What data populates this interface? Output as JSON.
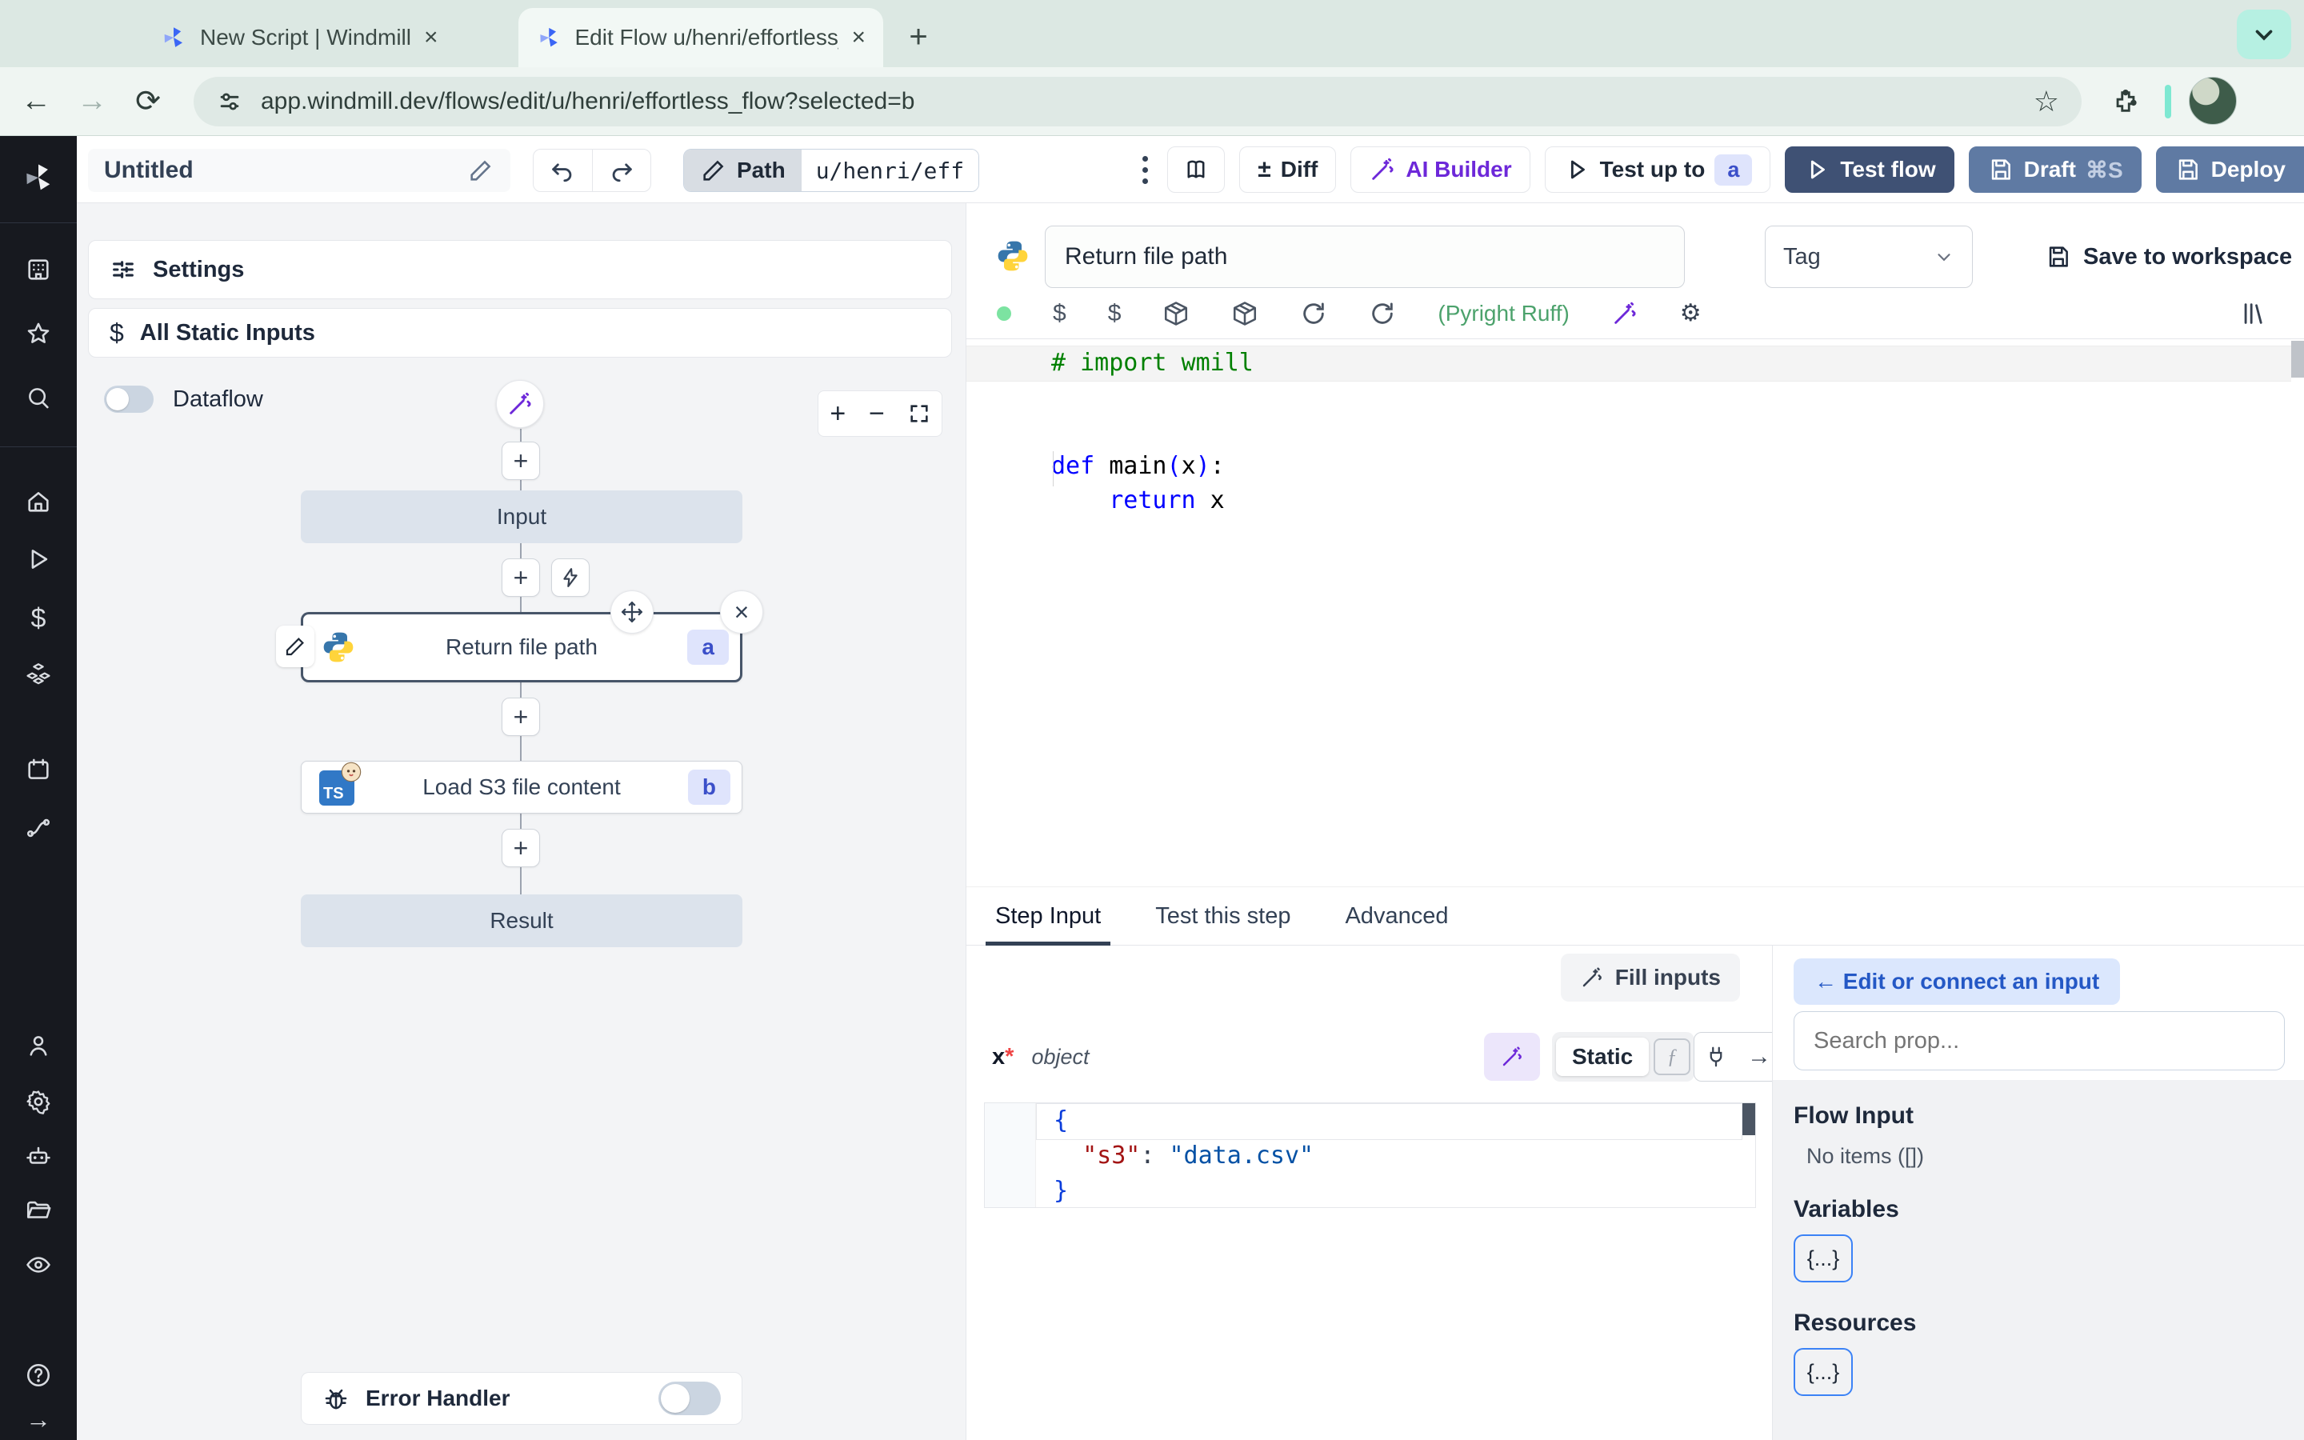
{
  "browser": {
    "tab1": "New Script | Windmill",
    "tab2": "Edit Flow u/henri/effortless_fl",
    "url": "app.windmill.dev/flows/edit/u/henri/effortless_flow?selected=b",
    "new_tab": "+",
    "close": "×"
  },
  "toolbar": {
    "title": "Untitled",
    "path_label": "Path",
    "path_value": "u/henri/eff",
    "diff_label": "Diff",
    "diff_icon": "±",
    "ai_builder_label": "AI Builder",
    "test_up_to_label": "Test up to",
    "step_badge_a": "a",
    "test_flow_label": "Test flow",
    "draft_label": "Draft",
    "draft_shortcut": "⌘S",
    "deploy_label": "Deploy"
  },
  "flow": {
    "settings_label": "Settings",
    "all_static_inputs_label": "All Static Inputs",
    "static_icon": "$",
    "dataflow_label": "Dataflow",
    "input_node": "Input",
    "step_a_label": "Return file path",
    "step_a_id": "a",
    "step_b_label": "Load S3 file content",
    "step_b_lang": "TS",
    "step_b_id": "b",
    "result_node": "Result",
    "error_handler_label": "Error Handler",
    "plus": "+",
    "minus": "−"
  },
  "step": {
    "name": "Return file path",
    "tag_label": "Tag",
    "save_label": "Save to workspace",
    "dollar1": "$",
    "dollar2": "$",
    "lint_status": "(Pyright Ruff)",
    "gear": "⚙",
    "code": {
      "comment": "# import wmill",
      "kw_def": "def",
      "fn_name": " main",
      "paren_open": "(",
      "arg": "x",
      "paren_close": ")",
      "colon": ":",
      "kw_return": "return",
      "ret_value": " x"
    },
    "tabs": {
      "step_input": "Step Input",
      "test_this_step": "Test this step",
      "advanced": "Advanced"
    },
    "fill_inputs_label": "Fill inputs",
    "arg_name": "x",
    "arg_required": "*",
    "arg_type": "object",
    "static_label": "Static",
    "fx_label": "ƒ",
    "arrow_right": "→",
    "json": {
      "open_brace": "{",
      "key": "\"s3\"",
      "colon": ":",
      "value": "\"data.csv\"",
      "close_brace": "}"
    }
  },
  "props": {
    "edit_connect_label": "← Edit or connect an input",
    "search_placeholder": "Search prop...",
    "flow_input_heading": "Flow Input",
    "no_items": "No items ([])",
    "variables_heading": "Variables",
    "resources_heading": "Resources",
    "braces_label": "{...}"
  }
}
